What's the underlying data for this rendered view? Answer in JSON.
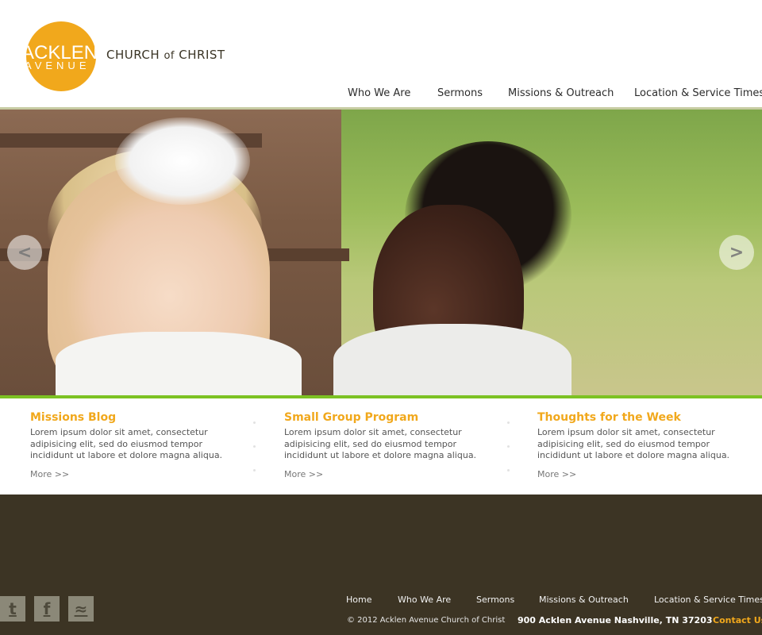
{
  "logo": {
    "word": "ACKLEN",
    "sub": "AVENUE",
    "tagline_before": "CHURCH",
    "tagline_of": "of",
    "tagline_after": "CHRIST"
  },
  "nav": {
    "items": [
      "Who We Are",
      "Sermons",
      "Missions & Outreach",
      "Location & Service Times"
    ]
  },
  "slider": {
    "prev_glyph": "<",
    "next_glyph": ">"
  },
  "features": [
    {
      "title": "Missions Blog",
      "text": "Lorem ipsum dolor sit amet, consectetur adipisicing elit, sed do eiusmod tempor incididunt ut labore et dolore magna aliqua.",
      "more": "More >>"
    },
    {
      "title": "Small Group Program",
      "text": "Lorem ipsum dolor sit amet, consectetur adipisicing elit, sed do eiusmod tempor incididunt ut labore et dolore magna aliqua.",
      "more": "More >>"
    },
    {
      "title": "Thoughts for the Week",
      "text": "Lorem ipsum dolor sit amet, consectetur adipisicing elit, sed do eiusmod tempor incididunt ut labore et dolore magna aliqua.",
      "more": "More >>"
    }
  ],
  "footer": {
    "social": [
      {
        "name": "twitter",
        "glyph": "t"
      },
      {
        "name": "facebook",
        "glyph": "f"
      },
      {
        "name": "rss",
        "glyph": "≈"
      }
    ],
    "nav": [
      "Home",
      "Who We Are",
      "Sermons",
      "Missions & Outreach",
      "Location & Service Times"
    ],
    "copyright": "© 2012  Acklen Avenue Church of Christ",
    "address": "900 Acklen Avenue Nashville, TN 37203",
    "contact": "Contact Us"
  },
  "colors": {
    "accent": "#f1a81c",
    "green": "#7cc223",
    "footer_bg": "#3c3424"
  }
}
